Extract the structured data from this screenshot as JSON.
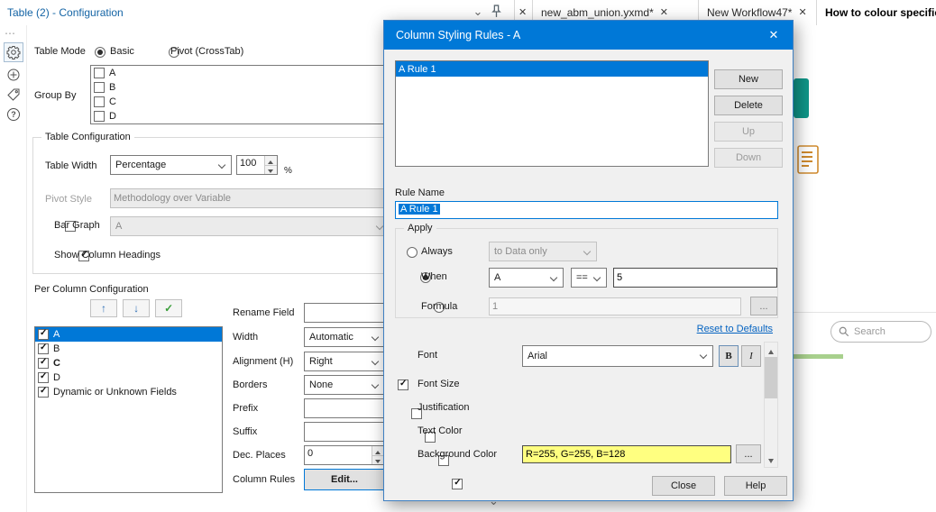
{
  "header": {
    "title": "Table (2) - Configuration"
  },
  "tabs": {
    "items": [
      {
        "label": "new_abm_union.yxmd*",
        "active": false
      },
      {
        "label": "New Workflow47*",
        "active": false
      },
      {
        "label": "How to colour specific",
        "active": true
      }
    ]
  },
  "config": {
    "table_mode": {
      "label": "Table Mode",
      "options": [
        "Basic",
        "Pivot (CrossTab)"
      ],
      "selected": "Basic"
    },
    "group_by": {
      "label": "Group By",
      "items": [
        "A",
        "B",
        "C",
        "D"
      ]
    },
    "table_configuration": {
      "title": "Table Configuration",
      "table_width_label": "Table Width",
      "table_width_value": "Percentage",
      "table_width_number": "100",
      "percent_suffix": "%",
      "pivot_style_label": "Pivot Style",
      "pivot_style_value": "Methodology over Variable",
      "bar_graph_label": "Bar Graph",
      "bar_graph_value": "A",
      "show_column_headings_label": "Show Column Headings"
    },
    "per_column": {
      "title": "Per Column Configuration",
      "columns": [
        {
          "label": "A",
          "checked": true,
          "selected": true
        },
        {
          "label": "B",
          "checked": true,
          "selected": false
        },
        {
          "label": "C",
          "checked": true,
          "selected": false
        },
        {
          "label": "D",
          "checked": true,
          "selected": false
        },
        {
          "label": "Dynamic or Unknown Fields",
          "checked": true,
          "selected": false
        }
      ],
      "fields": {
        "rename_label": "Rename Field",
        "rename_value": "",
        "width_label": "Width",
        "width_value": "Automatic",
        "alignment_label": "Alignment (H)",
        "alignment_value": "Right",
        "borders_label": "Borders",
        "borders_value": "None",
        "prefix_label": "Prefix",
        "prefix_value": "",
        "suffix_label": "Suffix",
        "suffix_value": "",
        "dec_places_label": "Dec. Places",
        "dec_places_value": "0",
        "column_rules_label": "Column Rules",
        "edit_button": "Edit..."
      }
    }
  },
  "dialog": {
    "title": "Column Styling Rules - A",
    "rules": [
      "A Rule 1"
    ],
    "new_button": "New",
    "delete_button": "Delete",
    "up_button": "Up",
    "down_button": "Down",
    "rule_name_label": "Rule Name",
    "rule_name_value": "A Rule 1",
    "apply": {
      "title": "Apply",
      "always_label": "Always",
      "always_value": "to Data only",
      "when_label": "When",
      "when_field": "A",
      "when_operator": "==",
      "when_value": "5",
      "formula_label": "Formula",
      "formula_value": "1",
      "browse_button": "..."
    },
    "reset_link": "Reset to Defaults",
    "styles": {
      "font_label": "Font",
      "font_value": "Arial",
      "bold_button": "B",
      "italic_button": "I",
      "font_size_label": "Font Size",
      "justification_label": "Justification",
      "text_color_label": "Text Color",
      "background_color_label": "Background Color",
      "background_color_value": "R=255, G=255, B=128",
      "background_browse": "...",
      "background_color_hex": "#ffff80"
    },
    "close_button": "Close",
    "help_button": "Help"
  },
  "canvas": {
    "search_placeholder": "Search"
  },
  "colors": {
    "accent_blue": "#0078d7",
    "title_blue": "#1464a5",
    "highlight_yellow": "#ffff80",
    "teal_tool": "#0f9688"
  }
}
